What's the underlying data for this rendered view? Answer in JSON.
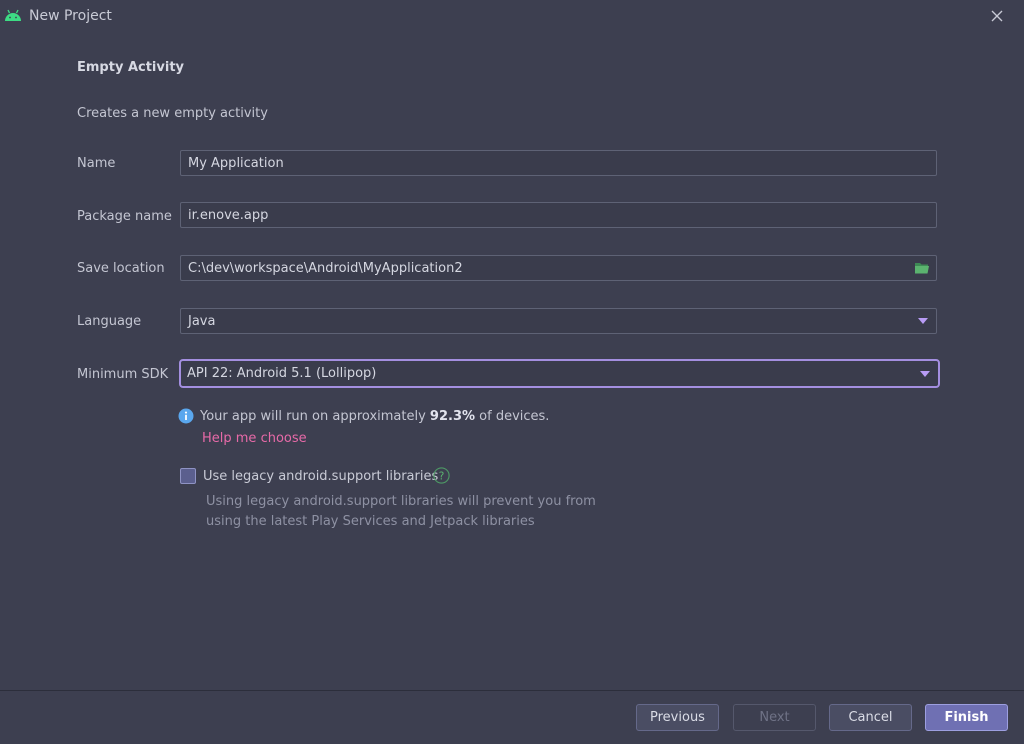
{
  "window": {
    "title": "New Project"
  },
  "form": {
    "heading": "Empty Activity",
    "description": "Creates a new empty activity",
    "name": {
      "label": "Name",
      "value": "My Application"
    },
    "package": {
      "label": "Package name",
      "value": "ir.enove.app"
    },
    "location": {
      "label": "Save location",
      "value": "C:\\dev\\workspace\\Android\\MyApplication2"
    },
    "language": {
      "label": "Language",
      "value": "Java"
    },
    "min_sdk": {
      "label": "Minimum SDK",
      "value": "API 22: Android 5.1 (Lollipop)"
    }
  },
  "info": {
    "prefix": "Your app will run on approximately ",
    "percent": "92.3%",
    "suffix": " of devices.",
    "help_link": "Help me choose"
  },
  "legacy": {
    "checked": false,
    "label": "Use legacy android.support libraries",
    "note": "Using legacy android.support libraries will prevent you from using the latest Play Services and Jetpack libraries"
  },
  "buttons": {
    "previous": "Previous",
    "next": "Next",
    "cancel": "Cancel",
    "finish": "Finish"
  },
  "icons": {
    "app": "android-icon",
    "close": "close-icon",
    "folder": "folder-open-icon",
    "info": "info-icon",
    "help": "question-icon",
    "dropdown": "dropdown-arrow-icon"
  },
  "colors": {
    "background": "#3d3f50",
    "accent": "#a48fe0",
    "link": "#e76aa8",
    "android_green": "#3ddc84",
    "info_blue": "#5aa7ee"
  }
}
